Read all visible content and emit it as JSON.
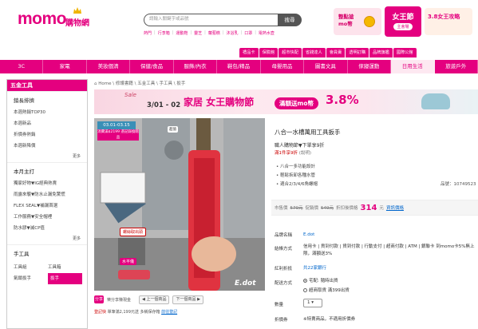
{
  "header": {
    "logo": "momo",
    "logo_cn": "購物網",
    "search_placeholder": "請輸入關鍵字或品號",
    "search_button": "搜尋",
    "hot_keywords": [
      "熱門",
      "行李箱",
      "運動鞋",
      "靈芝",
      "蘿蔔糕",
      "沐浴乳",
      "口罩",
      "電熱水壺"
    ]
  },
  "promos": {
    "p1": "整點搶 mo幣",
    "p2_title": "女王節",
    "p2_sub": "主會場",
    "p3": "3.8女王攻略"
  },
  "service_tabs": [
    "禮品卡",
    "保險館",
    "超市快配",
    "省錢達人",
    "會員賣",
    "透明訂購",
    "品牌旗艦",
    "國際公館"
  ],
  "categories": [
    "3C",
    "家電",
    "美妝個清",
    "保健/食品",
    "服飾/內衣",
    "鞋包/精品",
    "母嬰用品",
    "圖書文具",
    "傢寢運動",
    "日用生活",
    "旅遊戶外"
  ],
  "active_category": "日用生活",
  "sidebar": {
    "title": "五金工具",
    "sections": [
      {
        "heading": "銷長排擠",
        "links": [
          "本週熱銷TOP30",
          "本週新品",
          "折價券熱銷",
          "本週新降價"
        ],
        "more": "更多"
      },
      {
        "heading": "本月主打",
        "links": [
          "獨家好物▼IG經典熱賣",
          "雨露來襲▼防水止漏免驚慌",
          "FLEX SEAL▼補漏首選",
          "工作服務▼安全帽裡",
          "防水膠▼滅CP值"
        ],
        "more": "更多"
      }
    ],
    "tools_heading": "手工具",
    "tools": [
      "工具組",
      "工具箱",
      "氣鎖扳手",
      "扳手"
    ],
    "selected_tool": "扳手"
  },
  "breadcrumb": "Home \\ 修護書籍 \\ 五金工具 \\ 手工具 \\ 扳手",
  "banner": {
    "a": "Sale",
    "b": "3/01 - 02",
    "c": "家居 女王購物節",
    "d": "滿額送mo幣",
    "e": "3.8%"
  },
  "image": {
    "date_tag": "03.01-03.15",
    "gift_text": "消費滿$2199 憑記錄換贈品",
    "ad": "超值",
    "caption_1": "螺絲取出頭",
    "caption_2": "水平儀",
    "brand": "E.dot",
    "share_text": "分享",
    "share_label": "樂分享賺現金",
    "nav": [
      "上一個商品",
      "下一個商品"
    ],
    "cred_icon": "登記快",
    "cred_text": "單筆滿2,199元送 多稱保存箱",
    "cred_link": "前往登記"
  },
  "product": {
    "title": "八合一水槽萬用工具扳手",
    "sub1": "職人購物節▼下單享9折",
    "sub2": "滿1件享9折",
    "sub2_tail": "(說明)",
    "features": [
      "八合一多功能設計",
      "輕鬆拆卸各種水管",
      "適合2/3/4/6角螺帽"
    ],
    "code_label": "品號：",
    "code": "10749523",
    "market_label": "市售價",
    "market_price": "579元",
    "momo_label": "促銷價",
    "momo_price": "549元",
    "discount_label": "折扣後價格",
    "discount_price": "314",
    "discount_unit": "元",
    "discount_link": "資訊價格"
  },
  "specs": {
    "brand_label": "品牌名稱",
    "brand": "E.dot",
    "pay_label": "結帳方式",
    "pay": "信用卡 | 貨到付款 | 貨到付款 | 行動支付 | 超商付款 | ATM | 銀聯卡 到momo卡5%無上限，滿額送3%",
    "bonus_label": "紅利折抵",
    "bonus": "共22家銀行",
    "ship_label": "配送方式",
    "ship1": "宅配: 隨時出貨",
    "ship2": "超商取貨 滿399出貨",
    "qty_label": "數量",
    "qty": "1",
    "fold_label": "折價券",
    "fold": "※特賣商品，不適用折價券"
  }
}
